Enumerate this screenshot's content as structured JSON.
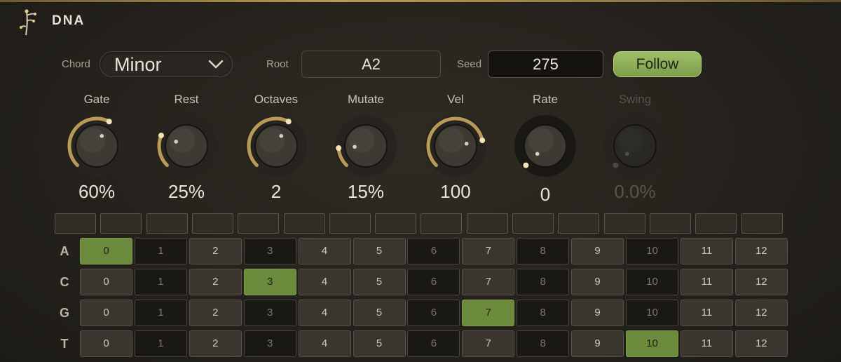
{
  "header": {
    "title": "DNA"
  },
  "controls": {
    "chord_label": "Chord",
    "chord_value": "Minor",
    "root_label": "Root",
    "root_value": "A2",
    "seed_label": "Seed",
    "seed_value": "275",
    "follow_label": "Follow"
  },
  "knobs": [
    {
      "label": "Gate",
      "value": "60%",
      "level": 0.6,
      "enabled": true
    },
    {
      "label": "Rest",
      "value": "25%",
      "level": 0.25,
      "enabled": true
    },
    {
      "label": "Octaves",
      "value": "2",
      "level": 0.6,
      "enabled": true
    },
    {
      "label": "Mutate",
      "value": "15%",
      "level": 0.15,
      "enabled": true
    },
    {
      "label": "Vel",
      "value": "100",
      "level": 0.79,
      "enabled": true
    },
    {
      "label": "Rate",
      "value": "0",
      "level": 0.0,
      "enabled": true
    },
    {
      "label": "Swing",
      "value": "0.0%",
      "level": 0.0,
      "enabled": false
    }
  ],
  "accent_color": "#b89a56",
  "active_color": "#6b8a3c",
  "step_count": 16,
  "grid": {
    "columns": [
      "0",
      "1",
      "2",
      "3",
      "4",
      "5",
      "6",
      "7",
      "8",
      "9",
      "10",
      "11",
      "12"
    ],
    "dark_columns": [
      1,
      3,
      6,
      8,
      10
    ],
    "rows": [
      {
        "label": "A",
        "active": 0
      },
      {
        "label": "C",
        "active": 3
      },
      {
        "label": "G",
        "active": 7
      },
      {
        "label": "T",
        "active": 10
      }
    ]
  }
}
